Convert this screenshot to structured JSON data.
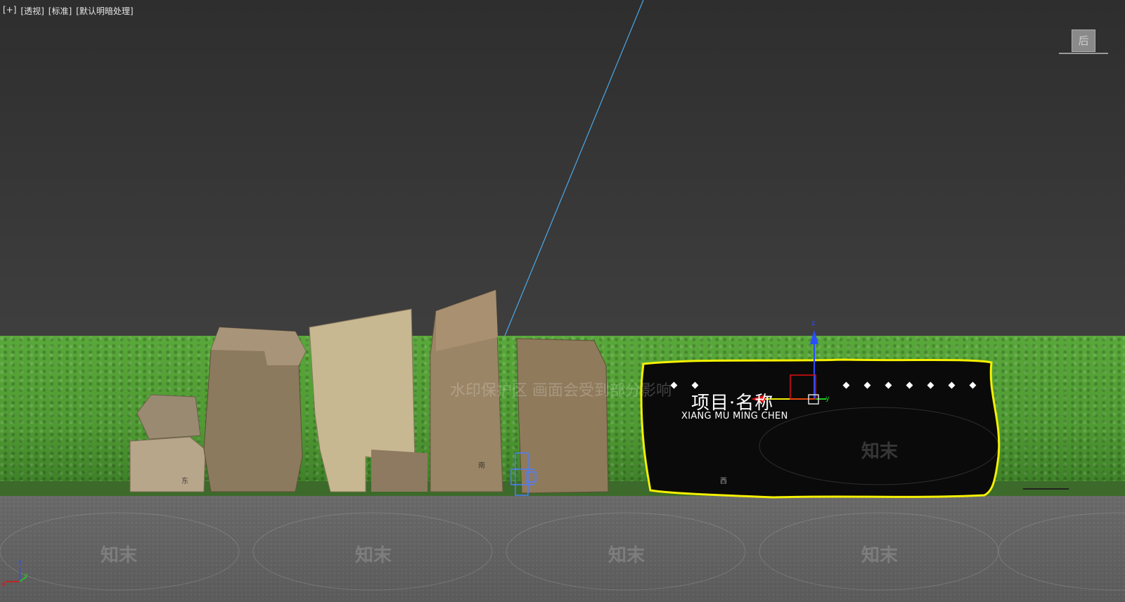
{
  "viewport_menu": {
    "plus": "[+]",
    "view": "[透视]",
    "shading": "[标准]",
    "lighting": "[默认明暗处理]"
  },
  "viewcube": {
    "face_label": "后"
  },
  "watermark": {
    "banner": "水印保护区  画面会受到部分影响",
    "logo": "知末"
  },
  "sign": {
    "title": "项目·名称",
    "subtitle": "XIANG MU MING CHEN"
  },
  "rock_labels": {
    "east": "东",
    "south": "南",
    "west": "西"
  },
  "gizmo": {
    "z": "z",
    "y": "y"
  },
  "world_axis": {
    "z": "z",
    "x": "x",
    "y": "y"
  },
  "colors": {
    "selection": "#f5f000",
    "sky_light_line": "#4aa8e8",
    "grass": "#4f9a33"
  }
}
